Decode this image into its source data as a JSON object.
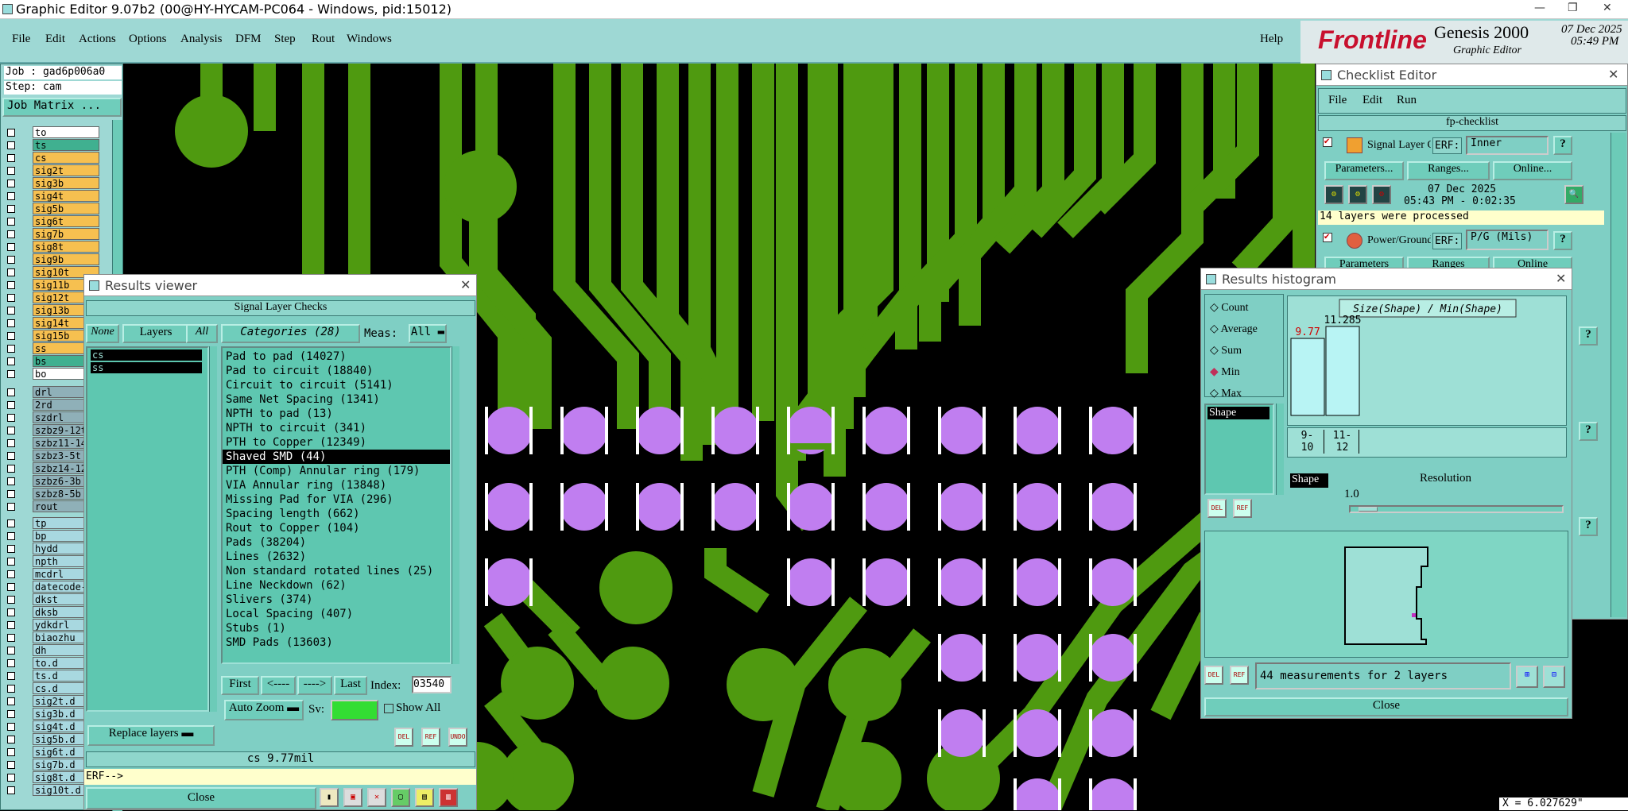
{
  "window": {
    "title": "Graphic Editor 9.07b2 (00@HY-HYCAM-PC064 - Windows, pid:15012)"
  },
  "menu": [
    "File",
    "Edit",
    "Actions",
    "Options",
    "Analysis",
    "DFM",
    "Step",
    "Rout",
    "Windows"
  ],
  "help": "Help",
  "brand": {
    "logo": "Frontline",
    "product": "Genesis 2000",
    "subtitle": "Graphic Editor",
    "date": "07 Dec 2025",
    "time": "05:49 PM"
  },
  "job": {
    "job": "Job : gad6p006a0",
    "step": "Step: cam",
    "matrix_btn": "Job Matrix ..."
  },
  "layers_board": [
    {
      "name": "to",
      "color": "#ffffff"
    },
    {
      "name": "ts",
      "color": "#40b090"
    },
    {
      "name": "cs",
      "color": "#f6c050"
    },
    {
      "name": "sig2t",
      "color": "#f6c050"
    },
    {
      "name": "sig3b",
      "color": "#f6c050"
    },
    {
      "name": "sig4t",
      "color": "#f6c050"
    },
    {
      "name": "sig5b",
      "color": "#f6c050"
    },
    {
      "name": "sig6t",
      "color": "#f6c050"
    },
    {
      "name": "sig7b",
      "color": "#f6c050"
    },
    {
      "name": "sig8t",
      "color": "#f6c050"
    },
    {
      "name": "sig9b",
      "color": "#f6c050"
    },
    {
      "name": "sig10t",
      "color": "#f6c050"
    },
    {
      "name": "sig11b",
      "color": "#f6c050"
    },
    {
      "name": "sig12t",
      "color": "#f6c050"
    },
    {
      "name": "sig13b",
      "color": "#f6c050"
    },
    {
      "name": "sig14t",
      "color": "#f6c050"
    },
    {
      "name": "sig15b",
      "color": "#f6c050"
    },
    {
      "name": "ss",
      "color": "#f6c050"
    },
    {
      "name": "bs",
      "color": "#40b090"
    },
    {
      "name": "bo",
      "color": "#ffffff"
    }
  ],
  "layers_drill": [
    "drl",
    "2rd",
    "szdrl",
    "szbz9-12t",
    "szbz11-14",
    "szbz3-5t",
    "szbz14-12",
    "szbz6-3b",
    "szbz8-5b",
    "rout"
  ],
  "layers_misc": [
    "tp",
    "bp",
    "hydd",
    "npth",
    "mcdrl",
    "datecode-",
    "dkst",
    "dksb",
    "ydkdrl",
    "biaozhu",
    "dh",
    "to.d",
    "ts.d",
    "cs.d",
    "sig2t.d",
    "sig3b.d",
    "sig4t.d",
    "sig5b.d",
    "sig6t.d",
    "sig7b.d",
    "sig8t.d",
    "sig10t.d"
  ],
  "results_viewer": {
    "title": "Results viewer",
    "header": "Signal Layer Checks",
    "none": "None",
    "layers": "Layers",
    "all": "All",
    "categories_label": "Categories (28)",
    "meas_label": "Meas:",
    "meas_value": "All",
    "layer_items": [
      "cs",
      "ss"
    ],
    "categories": [
      "Pad to pad (14027)",
      "Pad to circuit (18840)",
      "Circuit to circuit (5141)",
      "Same Net Spacing (1341)",
      "NPTH to pad (13)",
      "NPTH to circuit (341)",
      "PTH to Copper (12349)",
      "Shaved SMD (44)",
      "PTH (Comp) Annular ring (179)",
      "VIA Annular ring (13848)",
      "Missing Pad for VIA (296)",
      "Spacing length (662)",
      "Rout to Copper (104)",
      "Pads (38204)",
      "Lines (2632)",
      "Non standard rotated lines (25)",
      "Line Neckdown (62)",
      "Slivers (374)",
      "Local Spacing (407)",
      "Stubs (1)",
      "SMD Pads (13603)"
    ],
    "selected_index": 7,
    "nav": {
      "first": "First",
      "prev": "<----",
      "next": "---->",
      "last": "Last",
      "index_label": "Index:",
      "index_value": "03540"
    },
    "zoom": "Auto Zoom",
    "sv": "Sv:",
    "show_all": "Show All",
    "replace": "Replace layers",
    "icons": [
      "DEL",
      "REF",
      "UNDO"
    ],
    "status": "cs 9.77mil",
    "erf": "ERF-->",
    "close": "Close"
  },
  "checklist": {
    "title": "Checklist Editor",
    "menu": [
      "File",
      "Edit",
      "Run"
    ],
    "name": "fp-checklist",
    "check1": {
      "name": "Signal Layer Ch",
      "erf": "ERF:",
      "erf_val": "Inner",
      "params": "Parameters...",
      "ranges": "Ranges...",
      "online": "Online...",
      "date": "07 Dec 2025",
      "time": "05:43 PM - 0:02:35",
      "msg": "14 layers were processed"
    },
    "check2": {
      "name": "Power/Ground C",
      "erf": "ERF:",
      "erf_val": "P/G (Mils)",
      "params": "Parameters",
      "ranges": "Ranges",
      "online": "Online"
    }
  },
  "histogram": {
    "title": "Results histogram",
    "options": [
      "Count",
      "Average",
      "Sum",
      "Min",
      "Max"
    ],
    "selected": "Min",
    "list_item": "Shape",
    "chart_title": "Size(Shape) / Min(Shape)",
    "resolution_label": "Resolution",
    "resolution_value": "1.0",
    "shape_label": "Shape",
    "status": "44 measurements for 2 layers",
    "close": "Close",
    "icons": [
      "DEL",
      "REF"
    ]
  },
  "chart_data": {
    "type": "bar",
    "title": "Size(Shape) / Min(Shape)",
    "categories": [
      "9-10",
      "11-12"
    ],
    "values": [
      9.77,
      11.285
    ],
    "value_labels": [
      "9.77",
      "11.285"
    ],
    "value_label_colors": [
      "#d00000",
      "#000000"
    ]
  },
  "coords": "X = 6.027629\"",
  "colors": {
    "panel": "#7fcfc4",
    "menubar": "#9ed8d4",
    "copper": "#4f9a10",
    "pad": "#c07ef0",
    "board_bg": "#000000"
  }
}
